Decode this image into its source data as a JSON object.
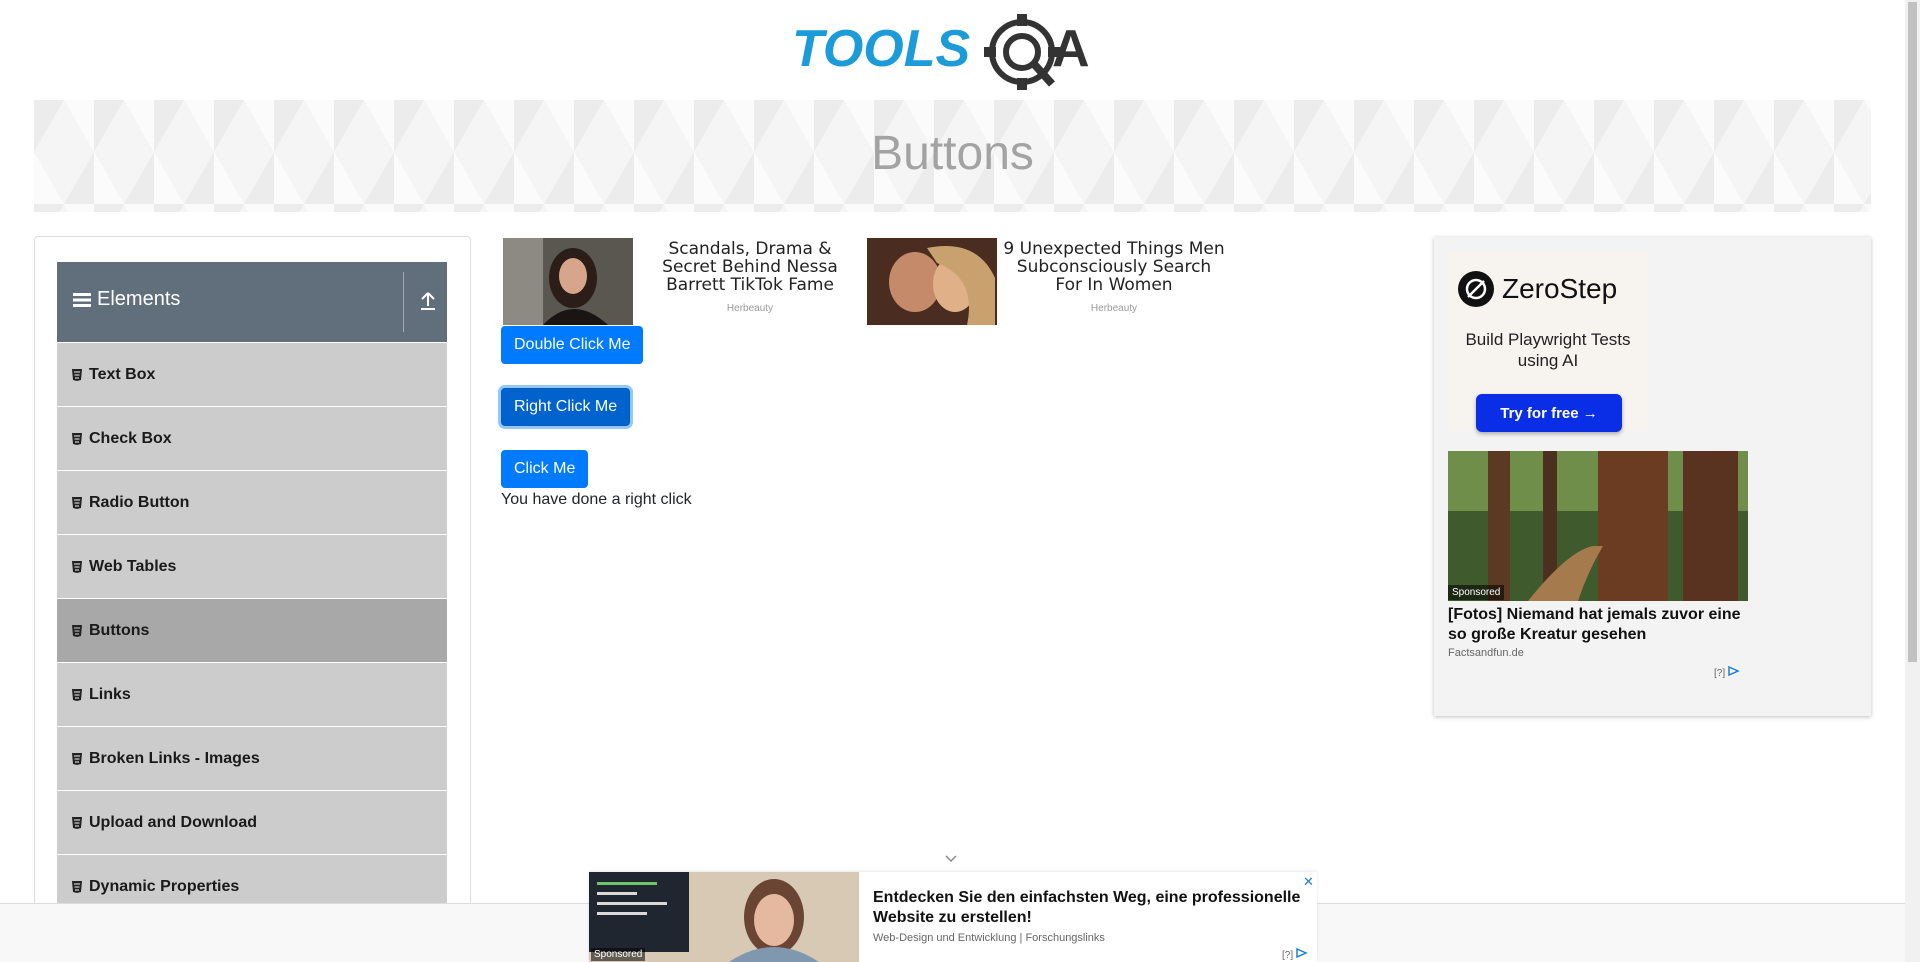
{
  "header": {
    "logo_text": "TOOLSQA"
  },
  "banner": {
    "title": "Buttons"
  },
  "sidebar": {
    "group_title": "Elements",
    "items": [
      {
        "label": "Text Box"
      },
      {
        "label": "Check Box"
      },
      {
        "label": "Radio Button"
      },
      {
        "label": "Web Tables"
      },
      {
        "label": "Buttons",
        "active": true
      },
      {
        "label": "Links"
      },
      {
        "label": "Broken Links - Images"
      },
      {
        "label": "Upload and Download"
      },
      {
        "label": "Dynamic Properties"
      }
    ]
  },
  "ads_top": [
    {
      "text": "Scandals, Drama & Secret Behind Nessa Barrett TikTok Fame",
      "source": "Herbeauty"
    },
    {
      "text": "9 Unexpected Things Men Subconsciously Search For In Women",
      "source": "Herbeauty"
    }
  ],
  "buttons": {
    "double_click": "Double Click Me",
    "right_click": "Right Click Me",
    "click": "Click Me"
  },
  "result_message": "You have done a right click",
  "right_ad": {
    "brand": "ZeroStep",
    "subtitle": "Build Playwright Tests using AI",
    "cta": "Try for free →",
    "badge": "Sponsored",
    "title": "[Fotos] Niemand hat jemals zuvor eine so große Kreatur gesehen",
    "source": "Factsandfun.de",
    "info": "[?]"
  },
  "bottom_ad": {
    "badge": "Sponsored",
    "headline": "Entdecken Sie den einfachsten Weg, eine professionelle Website zu erstellen!",
    "meta": "Web-Design und Entwicklung | Forschungslinks",
    "close": "✕",
    "info": "[?]"
  },
  "colors": {
    "primary": "#007bff",
    "sidebar_header": "#616e7c",
    "menu_bg": "#cccccc",
    "menu_active": "#a8a8a8",
    "cta": "#0a2ee6"
  }
}
